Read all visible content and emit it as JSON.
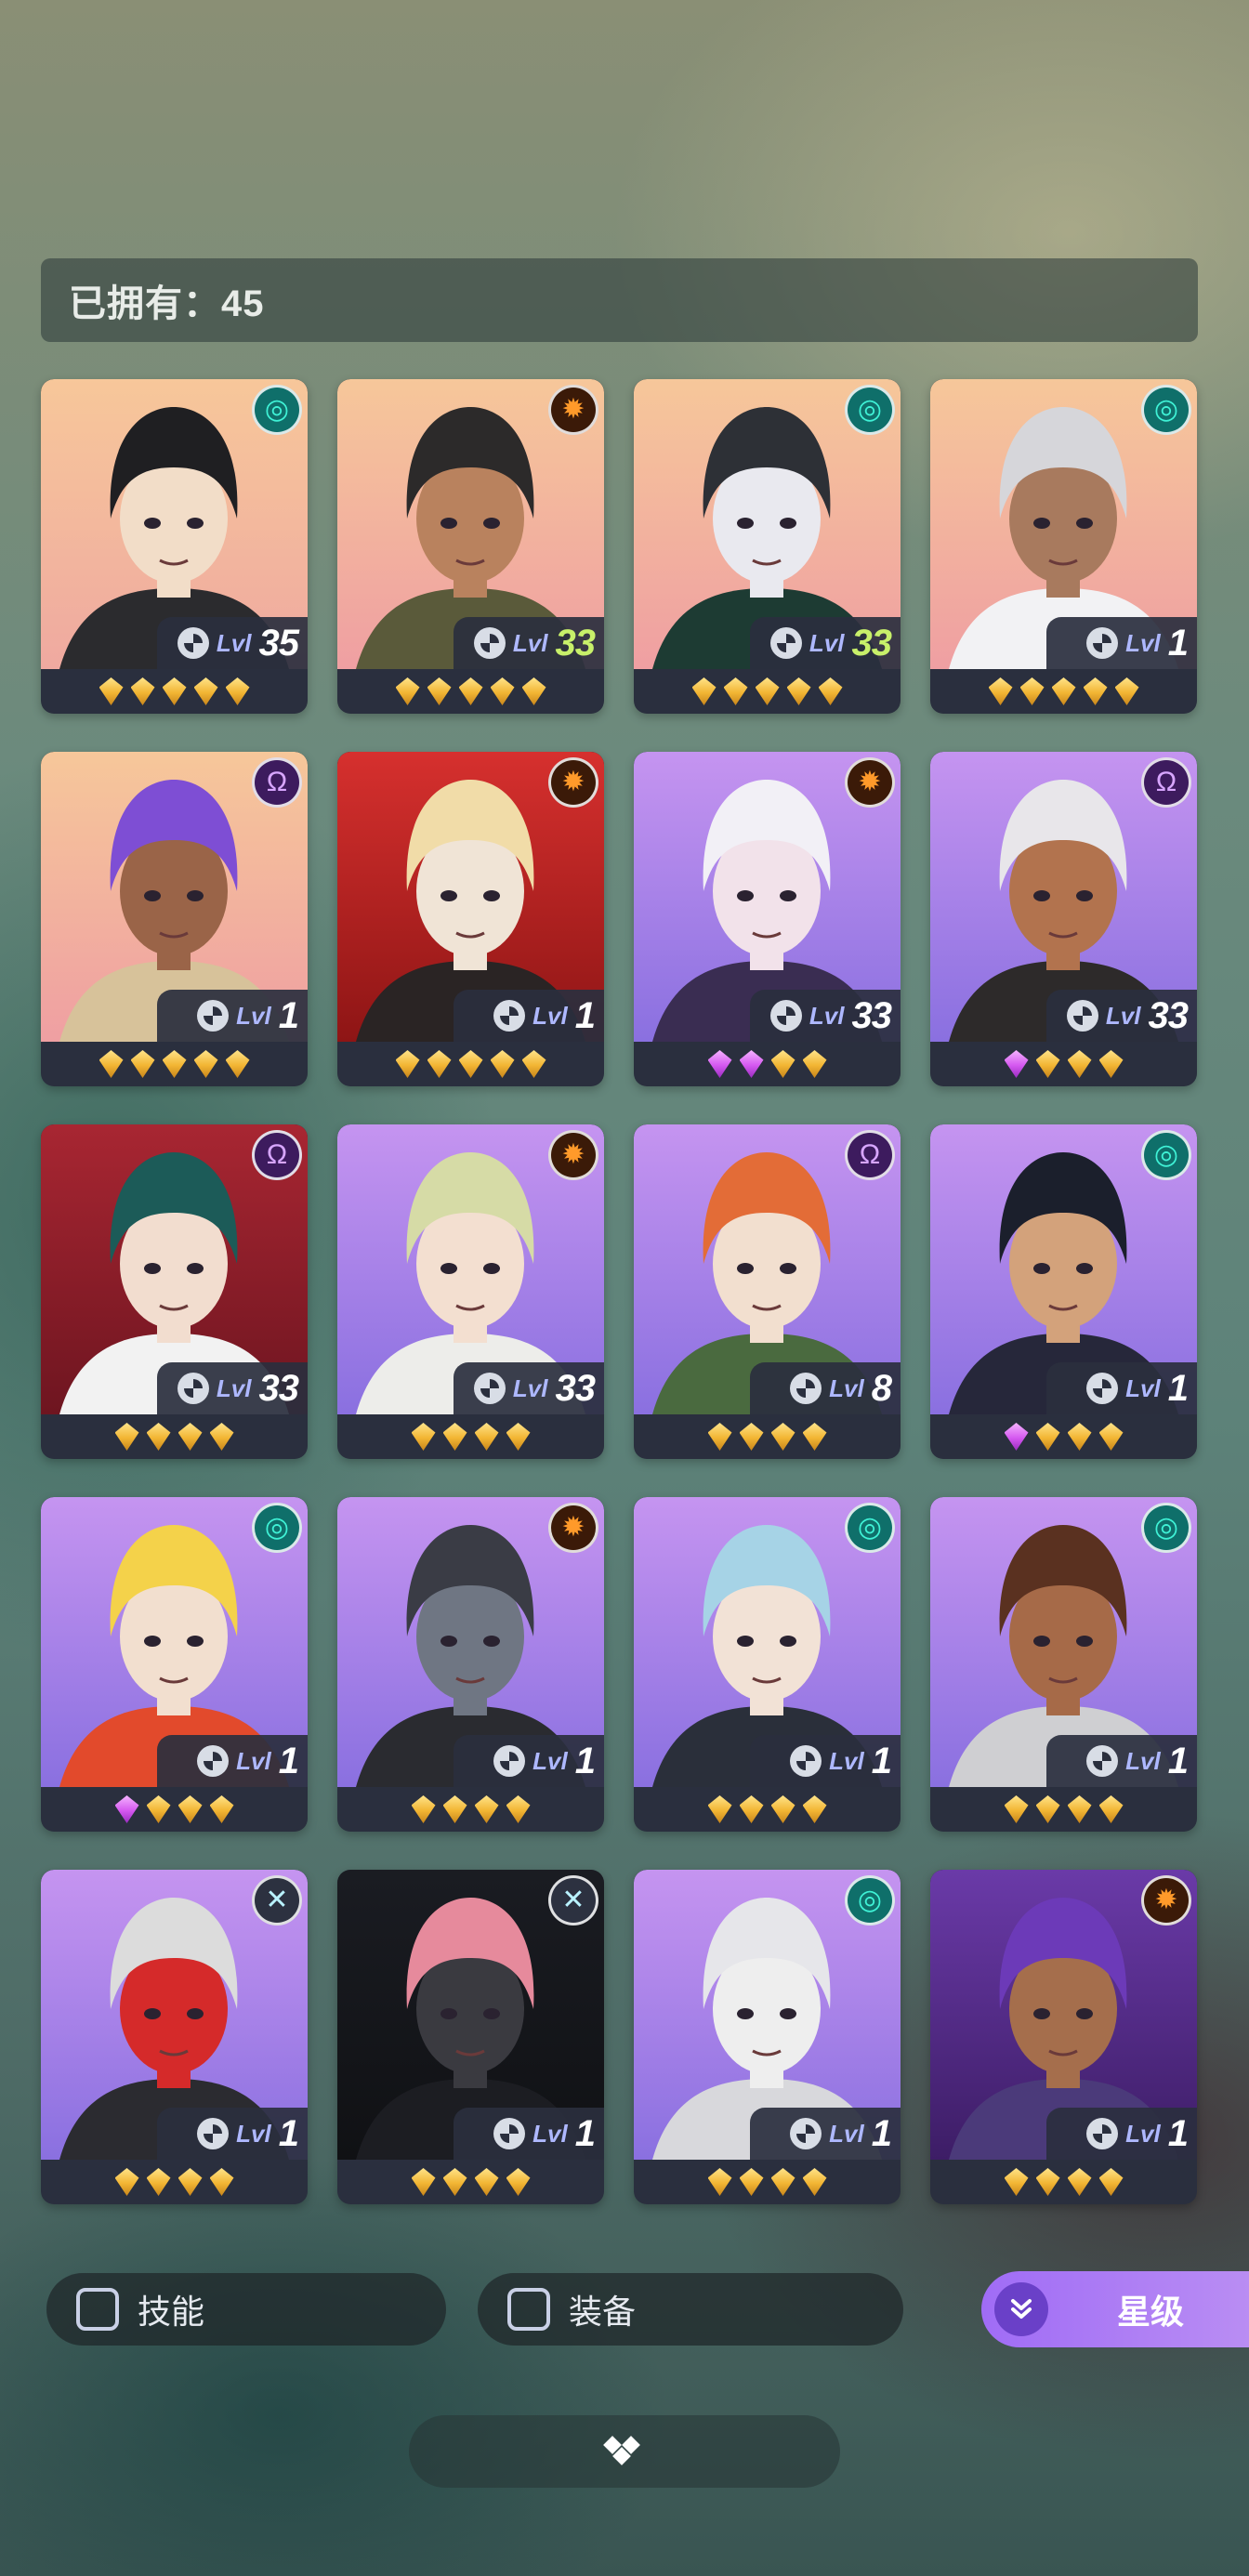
{
  "header": {
    "owned_text": "已拥有：45"
  },
  "colors": {
    "gem_gold": "#f2b533",
    "gem_purple": "#d558f0",
    "level_highlight": "#c8f06a",
    "accent_purple": "#a06cf6"
  },
  "level_prefix": "Lvl",
  "characters": [
    {
      "emblem": "teal",
      "emblem_icon": "◎",
      "level": "35",
      "hi": false,
      "gems": [
        "g",
        "g",
        "g",
        "g",
        "g"
      ],
      "bg": [
        "#f7c79a",
        "#efa9a0"
      ],
      "hair": "#1f1f22",
      "skin": "#f2ddc8",
      "outfit": "#2b2b2e"
    },
    {
      "emblem": "orange",
      "emblem_icon": "✹",
      "level": "33",
      "hi": true,
      "gems": [
        "g",
        "g",
        "g",
        "g",
        "g"
      ],
      "bg": [
        "#f6c79a",
        "#ef9fa2"
      ],
      "hair": "#2c2a2a",
      "skin": "#b9825e",
      "outfit": "#5a5a3a"
    },
    {
      "emblem": "teal",
      "emblem_icon": "◎",
      "level": "33",
      "hi": true,
      "gems": [
        "g",
        "g",
        "g",
        "g",
        "g"
      ],
      "bg": [
        "#f6c79a",
        "#ef9fa2"
      ],
      "hair": "#2d3036",
      "skin": "#e9e9ef",
      "outfit": "#1d3b33"
    },
    {
      "emblem": "teal",
      "emblem_icon": "◎",
      "level": "1",
      "hi": false,
      "gems": [
        "g",
        "g",
        "g",
        "g",
        "g"
      ],
      "bg": [
        "#f6c79a",
        "#ef9fa2"
      ],
      "hair": "#d6d6da",
      "skin": "#a87a5e",
      "outfit": "#f2f2f4"
    },
    {
      "emblem": "purple",
      "emblem_icon": "Ω",
      "level": "1",
      "hi": false,
      "gems": [
        "g",
        "g",
        "g",
        "g",
        "g"
      ],
      "bg": [
        "#f6c79a",
        "#ef9fa2"
      ],
      "hair": "#7e4ed4",
      "skin": "#9a6448",
      "outfit": "#d7c29a"
    },
    {
      "emblem": "orange",
      "emblem_icon": "✹",
      "level": "1",
      "hi": false,
      "gems": [
        "g",
        "g",
        "g",
        "g",
        "g"
      ],
      "bg": [
        "#d6302e",
        "#8e1515"
      ],
      "hair": "#f1dca8",
      "skin": "#f0e4d6",
      "outfit": "#2a2424"
    },
    {
      "emblem": "orange",
      "emblem_icon": "✹",
      "level": "33",
      "hi": false,
      "gems": [
        "p",
        "p",
        "g",
        "g"
      ],
      "bg": [
        "#c594f0",
        "#8a70e0"
      ],
      "hair": "#f2f0f6",
      "skin": "#f2e2ea",
      "outfit": "#3a2d52"
    },
    {
      "emblem": "purple",
      "emblem_icon": "Ω",
      "level": "33",
      "hi": false,
      "gems": [
        "p",
        "g",
        "g",
        "g"
      ],
      "bg": [
        "#c594f0",
        "#8a70e0"
      ],
      "hair": "#e8e6ea",
      "skin": "#b2734e",
      "outfit": "#2d2a2a"
    },
    {
      "emblem": "purple",
      "emblem_icon": "Ω",
      "level": "33",
      "hi": false,
      "gems": [
        "g",
        "g",
        "g",
        "g"
      ],
      "bg": [
        "#a82632",
        "#6e1520"
      ],
      "hair": "#1c5b58",
      "skin": "#f2ddcf",
      "outfit": "#f2f2f2"
    },
    {
      "emblem": "orange",
      "emblem_icon": "✹",
      "level": "33",
      "hi": false,
      "gems": [
        "g",
        "g",
        "g",
        "g"
      ],
      "bg": [
        "#c594f0",
        "#8a70e0"
      ],
      "hair": "#d6dba6",
      "skin": "#f3dfd0",
      "outfit": "#ededea"
    },
    {
      "emblem": "purple",
      "emblem_icon": "Ω",
      "level": "8",
      "hi": false,
      "gems": [
        "g",
        "g",
        "g",
        "g"
      ],
      "bg": [
        "#c594f0",
        "#8a70e0"
      ],
      "hair": "#e36c37",
      "skin": "#f2dfcf",
      "outfit": "#4a6a3f"
    },
    {
      "emblem": "teal",
      "emblem_icon": "◎",
      "level": "1",
      "hi": false,
      "gems": [
        "p",
        "g",
        "g",
        "g"
      ],
      "bg": [
        "#c594f0",
        "#8a70e0"
      ],
      "hair": "#1b1f2c",
      "skin": "#d3a27b",
      "outfit": "#26273a"
    },
    {
      "emblem": "teal",
      "emblem_icon": "◎",
      "level": "1",
      "hi": false,
      "gems": [
        "p",
        "g",
        "g",
        "g"
      ],
      "bg": [
        "#c594f0",
        "#8a70e0"
      ],
      "hair": "#f4d24a",
      "skin": "#f2dfcf",
      "outfit": "#e24a2c"
    },
    {
      "emblem": "orange",
      "emblem_icon": "✹",
      "level": "1",
      "hi": false,
      "gems": [
        "g",
        "g",
        "g",
        "g"
      ],
      "bg": [
        "#c594f0",
        "#8a70e0"
      ],
      "hair": "#3a3c45",
      "skin": "#6f7683",
      "outfit": "#2a2b30"
    },
    {
      "emblem": "teal",
      "emblem_icon": "◎",
      "level": "1",
      "hi": false,
      "gems": [
        "g",
        "g",
        "g",
        "g"
      ],
      "bg": [
        "#c594f0",
        "#8a70e0"
      ],
      "hair": "#a6d3e6",
      "skin": "#f2e2d6",
      "outfit": "#2a2f3a"
    },
    {
      "emblem": "teal",
      "emblem_icon": "◎",
      "level": "1",
      "hi": false,
      "gems": [
        "g",
        "g",
        "g",
        "g"
      ],
      "bg": [
        "#c594f0",
        "#8a70e0"
      ],
      "hair": "#5a3120",
      "skin": "#a66a48",
      "outfit": "#cfcfd2"
    },
    {
      "emblem": "white",
      "emblem_icon": "✕",
      "level": "1",
      "hi": false,
      "gems": [
        "g",
        "g",
        "g",
        "g"
      ],
      "bg": [
        "#c594f0",
        "#8a70e0"
      ],
      "hair": "#dcdcdc",
      "skin": "#d52a2a",
      "outfit": "#2b2b30"
    },
    {
      "emblem": "white",
      "emblem_icon": "✕",
      "level": "1",
      "hi": false,
      "gems": [
        "g",
        "g",
        "g",
        "g"
      ],
      "bg": [
        "#1a1c22",
        "#101114"
      ],
      "hair": "#e68a9c",
      "skin": "#3a3a40",
      "outfit": "#1c1d22"
    },
    {
      "emblem": "teal",
      "emblem_icon": "◎",
      "level": "1",
      "hi": false,
      "gems": [
        "g",
        "g",
        "g",
        "g"
      ],
      "bg": [
        "#c594f0",
        "#8a70e0"
      ],
      "hair": "#e6e6ea",
      "skin": "#eeeeee",
      "outfit": "#d8d8dc"
    },
    {
      "emblem": "orange",
      "emblem_icon": "✹",
      "level": "1",
      "hi": false,
      "gems": [
        "g",
        "g",
        "g",
        "g"
      ],
      "bg": [
        "#6a3aa8",
        "#3d1d66"
      ],
      "hair": "#6c3ab8",
      "skin": "#a56e4c",
      "outfit": "#4b3a7a"
    }
  ],
  "filters": {
    "skill_label": "技能",
    "equipment_label": "装备"
  },
  "sort": {
    "label": "星级",
    "icon": "chevron-double-down-icon"
  },
  "collapse": {
    "icon": "diamond-cluster-icon"
  }
}
